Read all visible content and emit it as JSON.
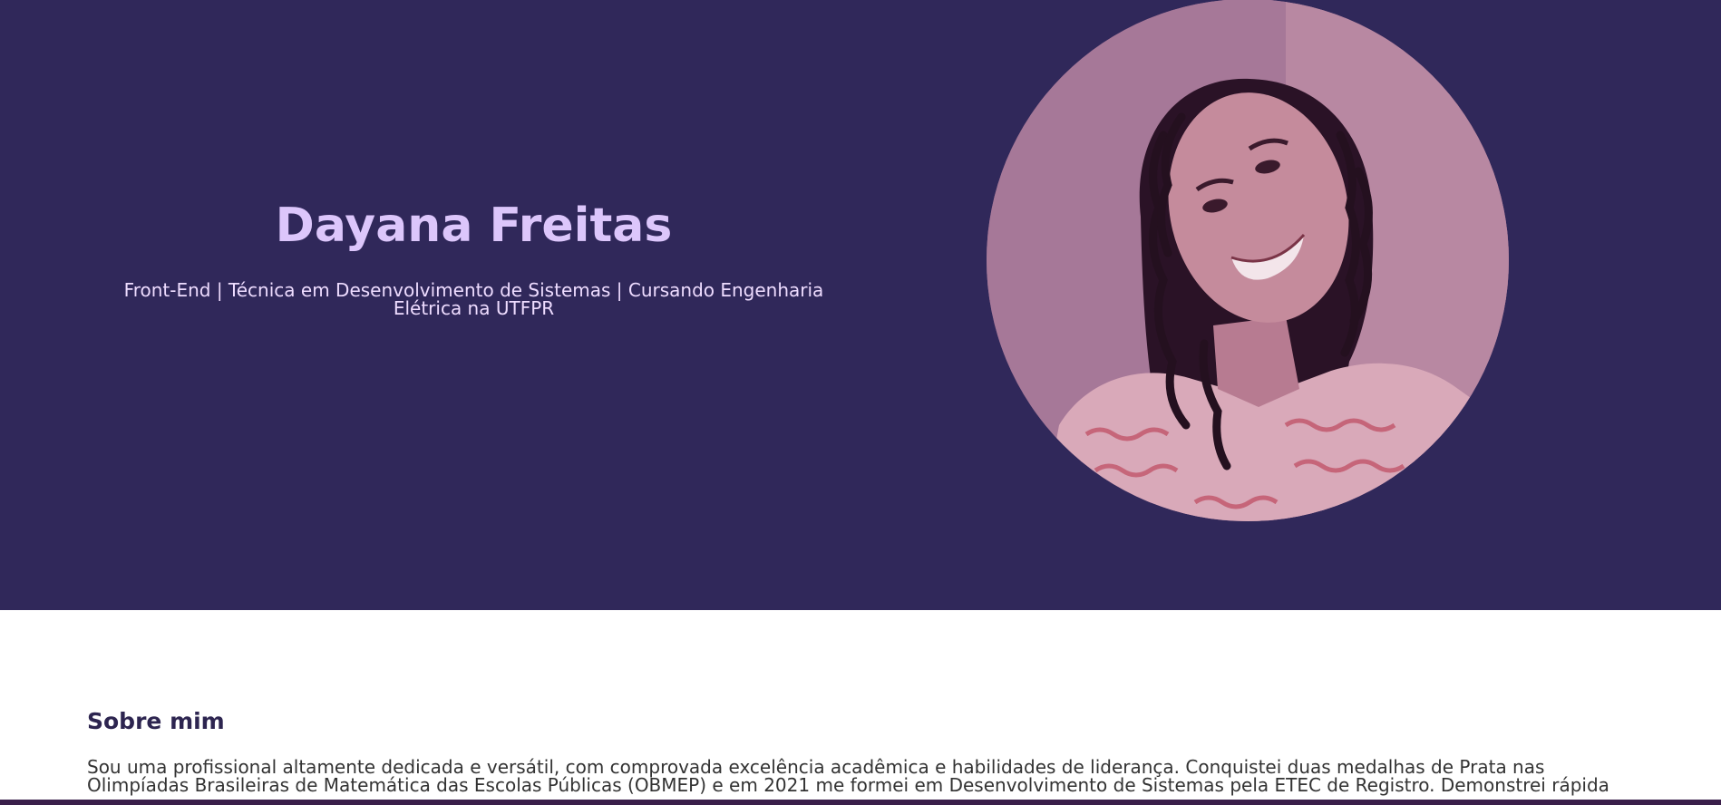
{
  "hero": {
    "name": "Dayana Freitas",
    "subtitle": "Front-End | Técnica em Desenvolvimento de Sistemas | Cursando Engenharia Elétrica na UTFPR",
    "photo_icon": "profile-photo"
  },
  "about": {
    "title": "Sobre mim",
    "text": "Sou uma profissional altamente dedicada e versátil, com comprovada excelência acadêmica e habilidades de liderança. Conquistei duas medalhas de Prata nas Olimpíadas Brasileiras de Matemática das Escolas Públicas (OBMEP) e em 2021 me formei em Desenvolvimento de Sistemas pela ETEC de Registro. Demonstrei rápida"
  },
  "colors": {
    "hero_bg": "#30285a",
    "name": "#dcc6fb",
    "accent": "#2d2550"
  }
}
